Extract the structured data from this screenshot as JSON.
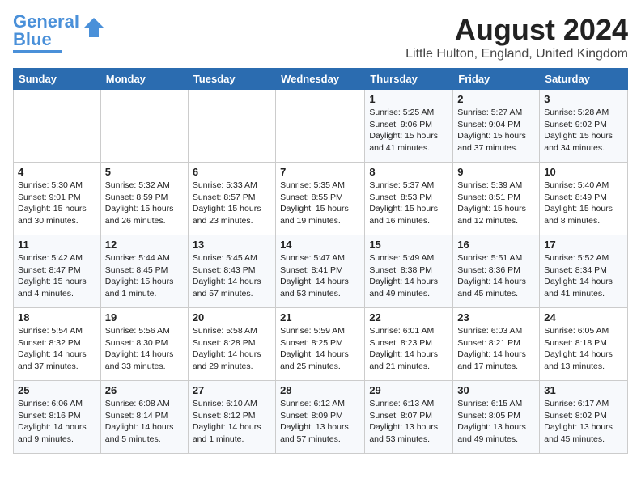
{
  "logo": {
    "line1": "General",
    "line2": "Blue"
  },
  "title": "August 2024",
  "location": "Little Hulton, England, United Kingdom",
  "weekdays": [
    "Sunday",
    "Monday",
    "Tuesday",
    "Wednesday",
    "Thursday",
    "Friday",
    "Saturday"
  ],
  "weeks": [
    [
      {
        "day": "",
        "info": ""
      },
      {
        "day": "",
        "info": ""
      },
      {
        "day": "",
        "info": ""
      },
      {
        "day": "",
        "info": ""
      },
      {
        "day": "1",
        "info": "Sunrise: 5:25 AM\nSunset: 9:06 PM\nDaylight: 15 hours\nand 41 minutes."
      },
      {
        "day": "2",
        "info": "Sunrise: 5:27 AM\nSunset: 9:04 PM\nDaylight: 15 hours\nand 37 minutes."
      },
      {
        "day": "3",
        "info": "Sunrise: 5:28 AM\nSunset: 9:02 PM\nDaylight: 15 hours\nand 34 minutes."
      }
    ],
    [
      {
        "day": "4",
        "info": "Sunrise: 5:30 AM\nSunset: 9:01 PM\nDaylight: 15 hours\nand 30 minutes."
      },
      {
        "day": "5",
        "info": "Sunrise: 5:32 AM\nSunset: 8:59 PM\nDaylight: 15 hours\nand 26 minutes."
      },
      {
        "day": "6",
        "info": "Sunrise: 5:33 AM\nSunset: 8:57 PM\nDaylight: 15 hours\nand 23 minutes."
      },
      {
        "day": "7",
        "info": "Sunrise: 5:35 AM\nSunset: 8:55 PM\nDaylight: 15 hours\nand 19 minutes."
      },
      {
        "day": "8",
        "info": "Sunrise: 5:37 AM\nSunset: 8:53 PM\nDaylight: 15 hours\nand 16 minutes."
      },
      {
        "day": "9",
        "info": "Sunrise: 5:39 AM\nSunset: 8:51 PM\nDaylight: 15 hours\nand 12 minutes."
      },
      {
        "day": "10",
        "info": "Sunrise: 5:40 AM\nSunset: 8:49 PM\nDaylight: 15 hours\nand 8 minutes."
      }
    ],
    [
      {
        "day": "11",
        "info": "Sunrise: 5:42 AM\nSunset: 8:47 PM\nDaylight: 15 hours\nand 4 minutes."
      },
      {
        "day": "12",
        "info": "Sunrise: 5:44 AM\nSunset: 8:45 PM\nDaylight: 15 hours\nand 1 minute."
      },
      {
        "day": "13",
        "info": "Sunrise: 5:45 AM\nSunset: 8:43 PM\nDaylight: 14 hours\nand 57 minutes."
      },
      {
        "day": "14",
        "info": "Sunrise: 5:47 AM\nSunset: 8:41 PM\nDaylight: 14 hours\nand 53 minutes."
      },
      {
        "day": "15",
        "info": "Sunrise: 5:49 AM\nSunset: 8:38 PM\nDaylight: 14 hours\nand 49 minutes."
      },
      {
        "day": "16",
        "info": "Sunrise: 5:51 AM\nSunset: 8:36 PM\nDaylight: 14 hours\nand 45 minutes."
      },
      {
        "day": "17",
        "info": "Sunrise: 5:52 AM\nSunset: 8:34 PM\nDaylight: 14 hours\nand 41 minutes."
      }
    ],
    [
      {
        "day": "18",
        "info": "Sunrise: 5:54 AM\nSunset: 8:32 PM\nDaylight: 14 hours\nand 37 minutes."
      },
      {
        "day": "19",
        "info": "Sunrise: 5:56 AM\nSunset: 8:30 PM\nDaylight: 14 hours\nand 33 minutes."
      },
      {
        "day": "20",
        "info": "Sunrise: 5:58 AM\nSunset: 8:28 PM\nDaylight: 14 hours\nand 29 minutes."
      },
      {
        "day": "21",
        "info": "Sunrise: 5:59 AM\nSunset: 8:25 PM\nDaylight: 14 hours\nand 25 minutes."
      },
      {
        "day": "22",
        "info": "Sunrise: 6:01 AM\nSunset: 8:23 PM\nDaylight: 14 hours\nand 21 minutes."
      },
      {
        "day": "23",
        "info": "Sunrise: 6:03 AM\nSunset: 8:21 PM\nDaylight: 14 hours\nand 17 minutes."
      },
      {
        "day": "24",
        "info": "Sunrise: 6:05 AM\nSunset: 8:18 PM\nDaylight: 14 hours\nand 13 minutes."
      }
    ],
    [
      {
        "day": "25",
        "info": "Sunrise: 6:06 AM\nSunset: 8:16 PM\nDaylight: 14 hours\nand 9 minutes."
      },
      {
        "day": "26",
        "info": "Sunrise: 6:08 AM\nSunset: 8:14 PM\nDaylight: 14 hours\nand 5 minutes."
      },
      {
        "day": "27",
        "info": "Sunrise: 6:10 AM\nSunset: 8:12 PM\nDaylight: 14 hours\nand 1 minute."
      },
      {
        "day": "28",
        "info": "Sunrise: 6:12 AM\nSunset: 8:09 PM\nDaylight: 13 hours\nand 57 minutes."
      },
      {
        "day": "29",
        "info": "Sunrise: 6:13 AM\nSunset: 8:07 PM\nDaylight: 13 hours\nand 53 minutes."
      },
      {
        "day": "30",
        "info": "Sunrise: 6:15 AM\nSunset: 8:05 PM\nDaylight: 13 hours\nand 49 minutes."
      },
      {
        "day": "31",
        "info": "Sunrise: 6:17 AM\nSunset: 8:02 PM\nDaylight: 13 hours\nand 45 minutes."
      }
    ]
  ]
}
